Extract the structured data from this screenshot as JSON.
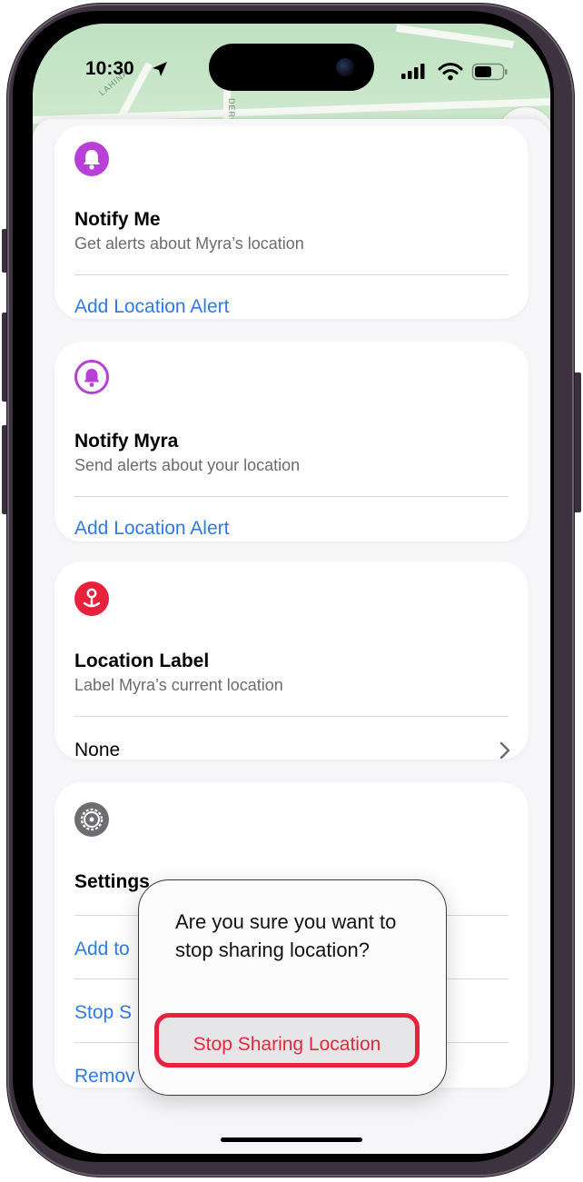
{
  "status_bar": {
    "time": "10:30"
  },
  "map": {
    "road_labels": [
      "LAHINA",
      "DERE"
    ]
  },
  "cards": {
    "notify_me": {
      "title": "Notify Me",
      "subtitle": "Get alerts about Myra’s location",
      "action": "Add Location Alert",
      "icon": "bell-icon",
      "icon_color": "#b840d8"
    },
    "notify_myra": {
      "title": "Notify Myra",
      "subtitle": "Send alerts about your location",
      "action": "Add Location Alert",
      "icon": "bell-outline-icon",
      "icon_color": "#b840d8"
    },
    "location_label": {
      "title": "Location Label",
      "subtitle": "Label Myra’s current location",
      "value": "None",
      "icon": "location-pin-icon",
      "icon_color": "#e8213e"
    },
    "settings": {
      "title": "Settings",
      "icon": "gear-icon",
      "icon_color": "#6d6d72",
      "items": [
        "Add to",
        "Stop S",
        "Remov"
      ]
    }
  },
  "popover": {
    "message": "Are you sure you want to stop sharing location?",
    "confirm_label": "Stop Sharing Location"
  },
  "colors": {
    "link": "#2f7ae5",
    "destructive": "#e6273f",
    "highlight": "#e8213e"
  }
}
